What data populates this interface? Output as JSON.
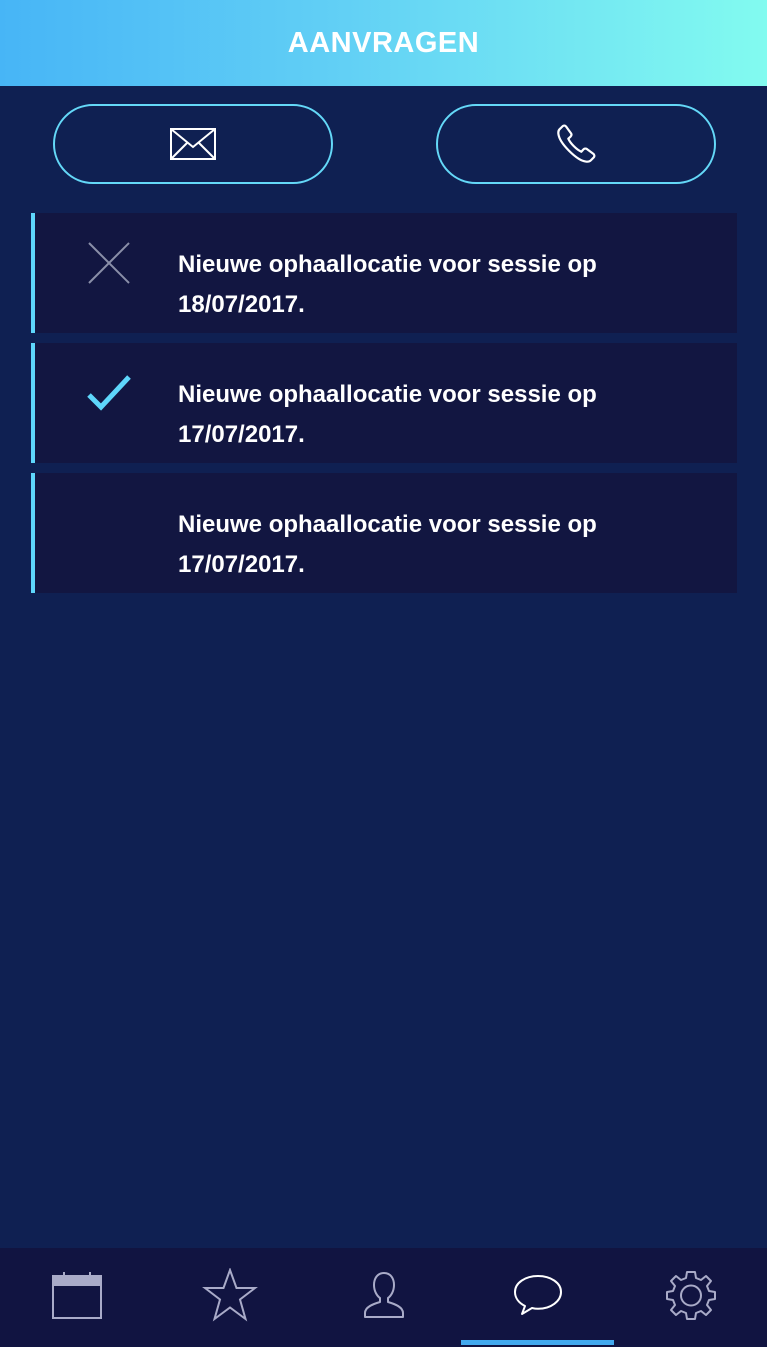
{
  "header": {
    "title": "AANVRAGEN"
  },
  "contact": {
    "mail_icon": "envelope-icon",
    "phone_icon": "phone-icon"
  },
  "requests": [
    {
      "status": "rejected",
      "status_icon": "close-icon",
      "text": "Nieuwe ophaallocatie voor sessie op 18/07/2017."
    },
    {
      "status": "accepted",
      "status_icon": "check-icon",
      "text": "Nieuwe ophaallocatie voor sessie op 17/07/2017."
    },
    {
      "status": "pending",
      "status_icon": "",
      "text": "Nieuwe ophaallocatie voor sessie op 17/07/2017."
    }
  ],
  "tabs": [
    {
      "icon": "calendar-icon",
      "active": false
    },
    {
      "icon": "star-icon",
      "active": false
    },
    {
      "icon": "profile-icon",
      "active": false
    },
    {
      "icon": "chat-bubble-icon",
      "active": true
    },
    {
      "icon": "gear-icon",
      "active": false
    }
  ],
  "colors": {
    "background": "#0f2052",
    "card": "#121641",
    "accent": "#5ed6fb",
    "tabbar": "#111441",
    "tab_indicator": "#42a9ee",
    "header_gradient_start": "#47b5f6",
    "header_gradient_end": "#82fbf0"
  }
}
